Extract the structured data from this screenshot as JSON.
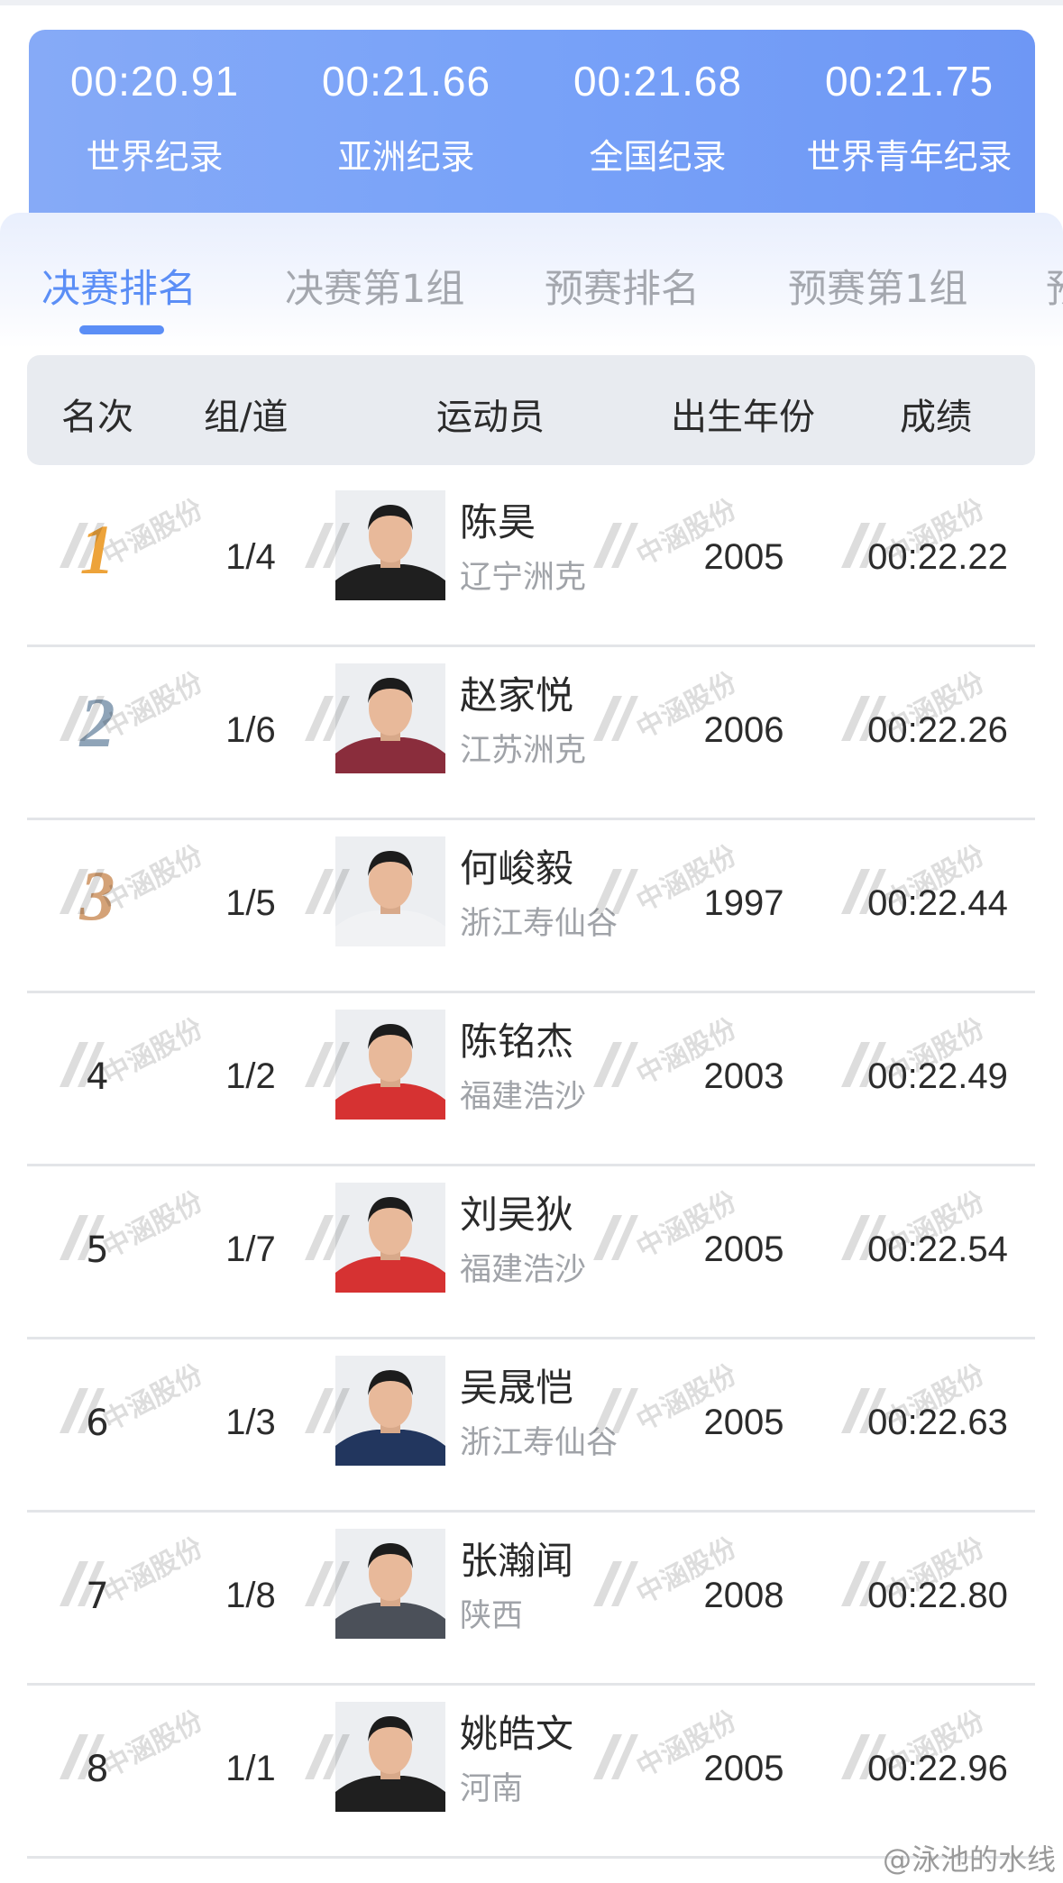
{
  "records": [
    {
      "time": "00:20.91",
      "label": "世界纪录"
    },
    {
      "time": "00:21.66",
      "label": "亚洲纪录"
    },
    {
      "time": "00:21.68",
      "label": "全国纪录"
    },
    {
      "time": "00:21.75",
      "label": "世界青年纪录"
    }
  ],
  "tabs": [
    {
      "label": "决赛排名",
      "active": true
    },
    {
      "label": "决赛第1组",
      "active": false
    },
    {
      "label": "预赛排名",
      "active": false
    },
    {
      "label": "预赛第1组",
      "active": false
    },
    {
      "label": "预",
      "active": false
    }
  ],
  "table": {
    "headers": {
      "rank": "名次",
      "lane": "组/道",
      "athlete": "运动员",
      "birth": "出生年份",
      "result": "成绩"
    },
    "rows": [
      {
        "rank": "1",
        "lane": "1/4",
        "name": "陈昊",
        "team": "辽宁洲克",
        "birth": "2005",
        "time": "00:22.22"
      },
      {
        "rank": "2",
        "lane": "1/6",
        "name": "赵家悦",
        "team": "江苏洲克",
        "birth": "2006",
        "time": "00:22.26"
      },
      {
        "rank": "3",
        "lane": "1/5",
        "name": "何峻毅",
        "team": "浙江寿仙谷",
        "birth": "1997",
        "time": "00:22.44"
      },
      {
        "rank": "4",
        "lane": "1/2",
        "name": "陈铭杰",
        "team": "福建浩沙",
        "birth": "2003",
        "time": "00:22.49"
      },
      {
        "rank": "5",
        "lane": "1/7",
        "name": "刘吴狄",
        "team": "福建浩沙",
        "birth": "2005",
        "time": "00:22.54"
      },
      {
        "rank": "6",
        "lane": "1/3",
        "name": "吴晟恺",
        "team": "浙江寿仙谷",
        "birth": "2005",
        "time": "00:22.63"
      },
      {
        "rank": "7",
        "lane": "1/8",
        "name": "张瀚闻",
        "team": "陕西",
        "birth": "2008",
        "time": "00:22.80"
      },
      {
        "rank": "8",
        "lane": "1/1",
        "name": "姚皓文",
        "team": "河南",
        "birth": "2005",
        "time": "00:22.96"
      }
    ]
  },
  "watermark_text": "中涵股份",
  "credit": "@泳池的水线",
  "colors": {
    "accent": "#5b8ef6",
    "banner_start": "#86aaf7",
    "banner_end": "#6e97f5",
    "gold": "#eda33a",
    "silver": "#8fa4b8",
    "bronze": "#d4a277"
  },
  "shirt_colors": [
    "#1f1f1f",
    "#8a2d3c",
    "#f1f2f4",
    "#d63232",
    "#d63232",
    "#22365e",
    "#4b5059",
    "#1f1f1f"
  ]
}
